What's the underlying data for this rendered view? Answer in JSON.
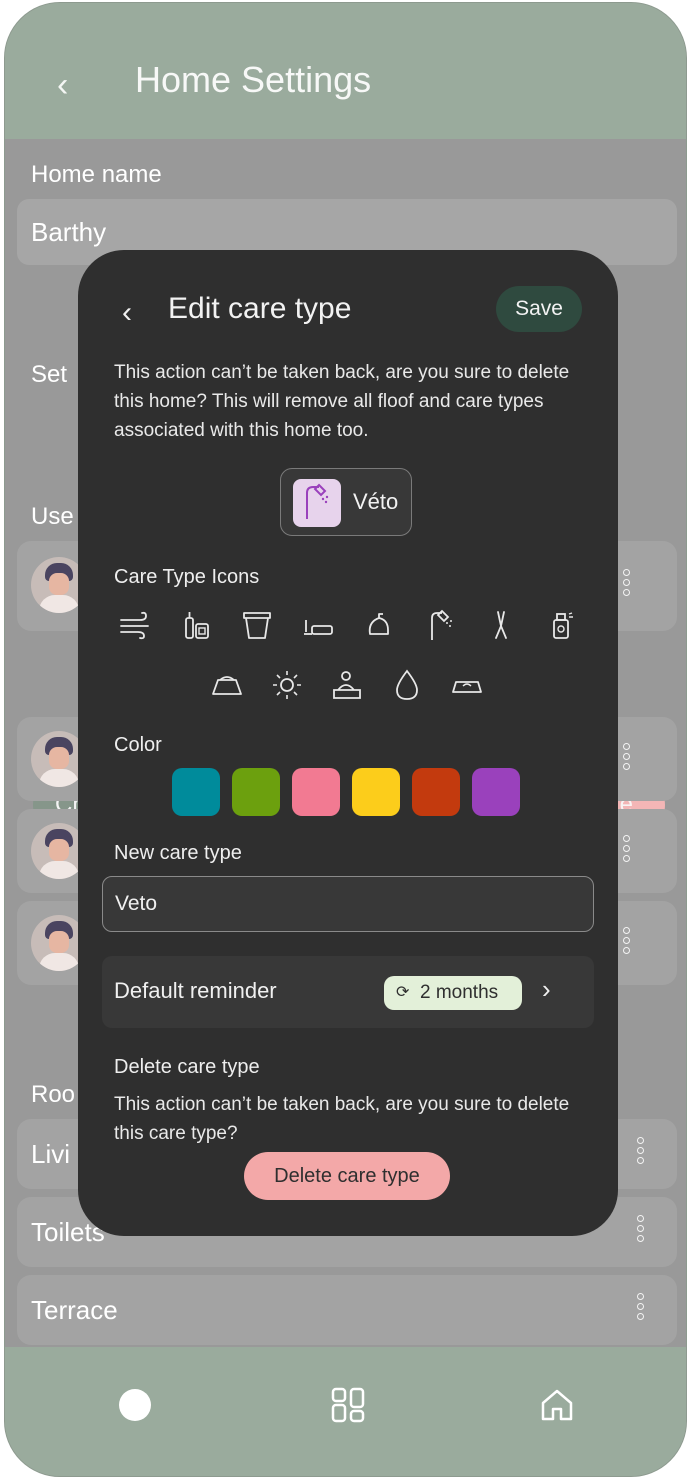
{
  "header": {
    "title": "Home Settings",
    "back_icon": "chevron-left-icon"
  },
  "home": {
    "name_label": "Home name",
    "name_value": "Barthy"
  },
  "background": {
    "set_label": "Set",
    "users_label": "Use",
    "rooms_label": "Roo",
    "pill_left": "Ch",
    "pill_right": "te",
    "rooms": [
      "Livi",
      "Toilets",
      "Terrace"
    ]
  },
  "modal": {
    "title": "Edit care type",
    "save_label": "Save",
    "description": "This action can’t be taken back, are you sure to delete this home? This will remove all floof and care types associated with this home too.",
    "preview_name": "Véto",
    "icons_label": "Care Type Icons",
    "icons_row1": [
      "wind-icon",
      "bottles-icon",
      "pot-icon",
      "pipette-icon",
      "kettle-icon",
      "shower-icon",
      "clippers-icon",
      "spray-icon"
    ],
    "icons_row2": [
      "food-bowl-icon",
      "sun-icon",
      "vet-icon",
      "drop-icon",
      "litter-tray-icon"
    ],
    "color_label": "Color",
    "colors": [
      "#008B9B",
      "#6CA00E",
      "#F27A92",
      "#FCCD1B",
      "#C33A0E",
      "#9A41BC"
    ],
    "new_label": "New care type",
    "new_value": "Veto",
    "reminder_label": "Default reminder",
    "reminder_value": "2 months",
    "delete_title": "Delete care type",
    "delete_desc": "This action can’t be taken back, are you sure to delete this care type?",
    "delete_button": "Delete care type"
  }
}
